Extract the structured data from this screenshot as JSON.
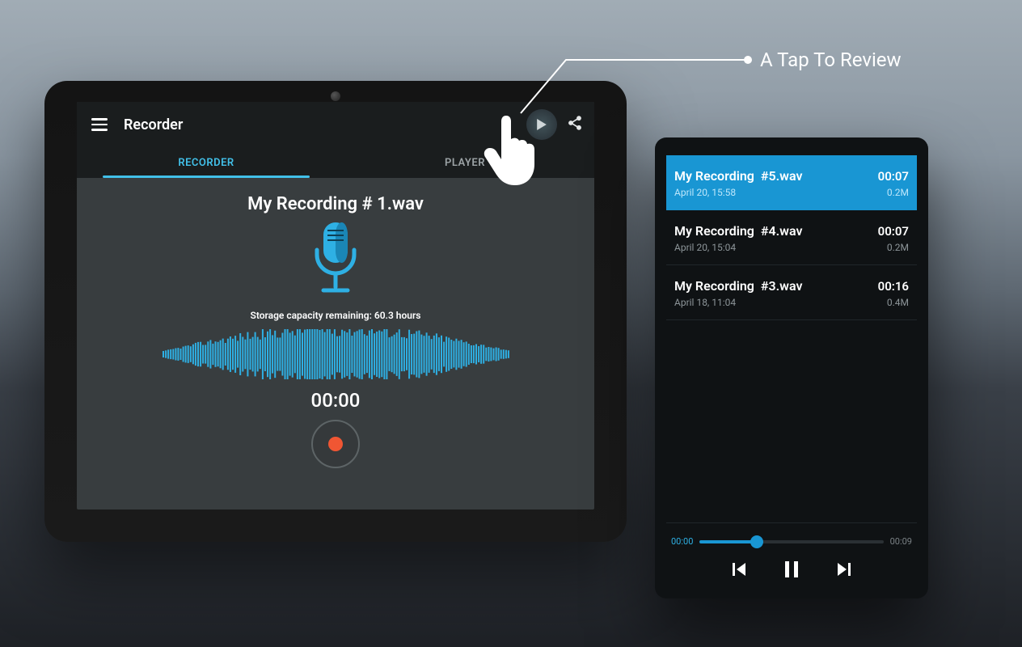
{
  "callout": {
    "text": "A Tap To Review"
  },
  "app": {
    "title": "Recorder",
    "tabs": {
      "recorder": "RECORDER",
      "player": "PLAYER"
    }
  },
  "recorder": {
    "file_name": "My Recording # 1.wav",
    "storage_line": "Storage capacity remaining: 60.3 hours",
    "timer": "00:00"
  },
  "playlist": {
    "items": [
      {
        "name_prefix": "My Recording",
        "name_suffix": "#5.wav",
        "duration": "00:07",
        "date": "April 20, 15:58",
        "size": "0.2M",
        "selected": true
      },
      {
        "name_prefix": "My Recording",
        "name_suffix": "#4.wav",
        "duration": "00:07",
        "date": "April 20, 15:04",
        "size": "0.2M",
        "selected": false
      },
      {
        "name_prefix": "My Recording",
        "name_suffix": "#3.wav",
        "duration": "00:16",
        "date": "April 18, 11:04",
        "size": "0.4M",
        "selected": false
      }
    ]
  },
  "player": {
    "position": "00:00",
    "duration": "00:09"
  },
  "colors": {
    "accent": "#1996d3",
    "wave": "#2eb0e4"
  }
}
